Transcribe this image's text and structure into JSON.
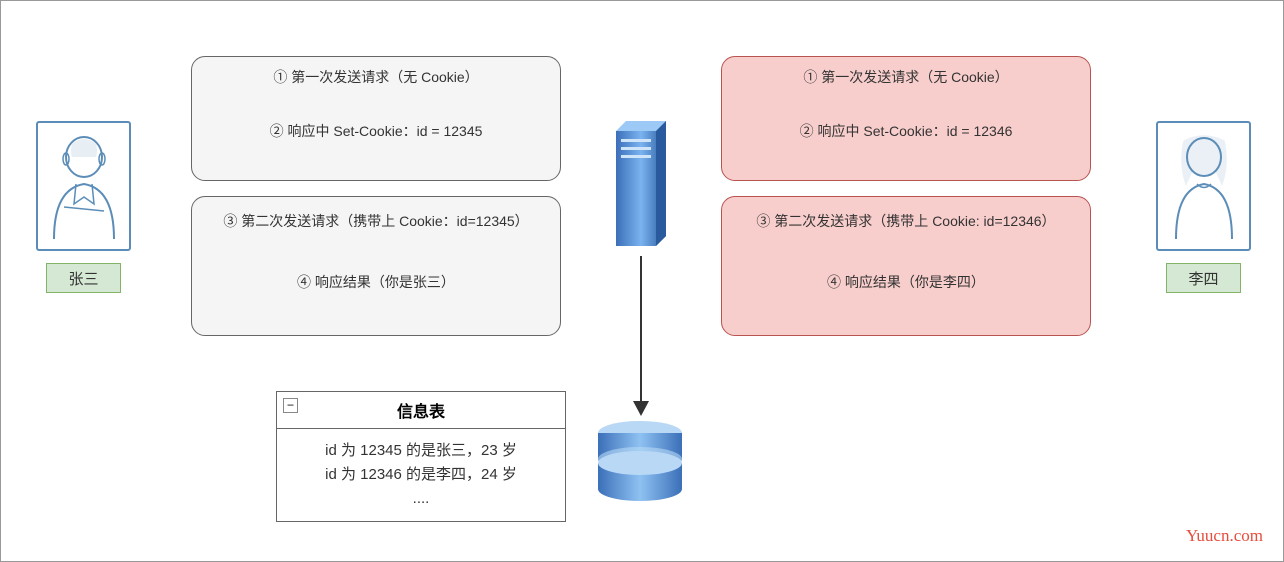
{
  "left_user": {
    "name": "张三"
  },
  "right_user": {
    "name": "李四"
  },
  "left_box1": {
    "line1": "① 第一次发送请求（无 Cookie）",
    "line2": "② 响应中 Set-Cookie：id = 12345"
  },
  "left_box2": {
    "line1": "③ 第二次发送请求（携带上 Cookie：id=12345）",
    "line2": "④ 响应结果（你是张三）"
  },
  "right_box1": {
    "line1": "① 第一次发送请求（无 Cookie）",
    "line2": "② 响应中 Set-Cookie：id = 12346"
  },
  "right_box2": {
    "line1": "③ 第二次发送请求（携带上 Cookie: id=12346）",
    "line2": "④ 响应结果（你是李四）"
  },
  "info_table": {
    "title": "信息表",
    "row1": "id 为 12345 的是张三，23 岁",
    "row2": "id 为 12346 的是李四，24 岁",
    "row3": "...."
  },
  "watermark": "Yuucn.com",
  "colors": {
    "arrow_blue": "#4a90d9",
    "gray_fill": "#f5f5f5",
    "red_fill": "#f8cecc",
    "name_fill": "#d5e8d4"
  }
}
